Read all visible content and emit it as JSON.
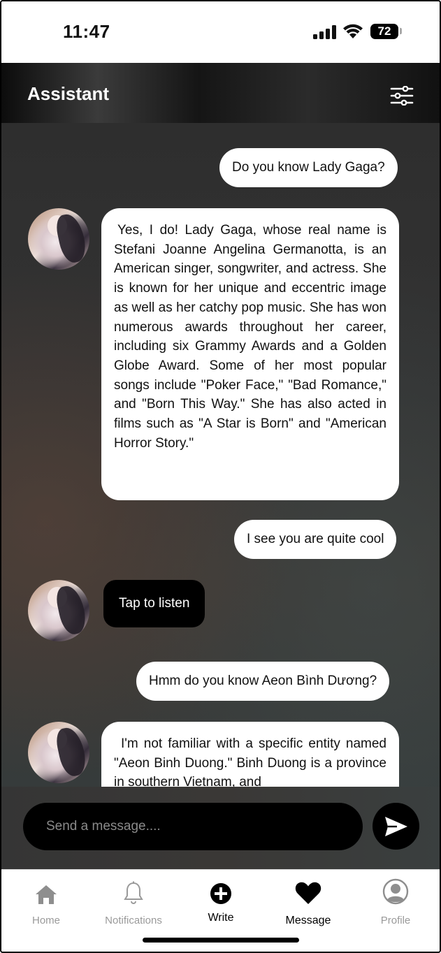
{
  "status_bar": {
    "time": "11:47",
    "battery": "72"
  },
  "header": {
    "title": "Assistant"
  },
  "messages": {
    "m1": "Do you know Lady Gaga?",
    "m2": "Yes, I do! Lady Gaga, whose real name is Stefani Joanne Angelina Germanotta, is an American singer, songwriter, and actress. She is known for her unique and eccentric image as well as her catchy pop music. She has won numerous awards throughout her career, including six Grammy Awards and a Golden Globe Award. Some of her most popular songs include \"Poker Face,\" \"Bad Romance,\" and \"Born This Way.\" She has also acted in films such as \"A Star is Born\" and \"American Horror Story.\"",
    "m3": "I see you are quite cool",
    "m4": "Tap to listen",
    "m5": "Hmm do you know Aeon Bình Dương?",
    "m6": "I'm not familiar with a specific entity named \"Aeon Binh Duong.\" Binh Duong is a province in southern Vietnam, and"
  },
  "composer": {
    "placeholder": "Send a message...."
  },
  "tabs": {
    "home": "Home",
    "notifications": "Notifications",
    "write": "Write",
    "message": "Message",
    "profile": "Profile"
  },
  "icons": {
    "status": [
      "signal-icon",
      "wifi-icon",
      "battery-icon"
    ],
    "header": [
      "settings-sliders-icon"
    ],
    "composer": [
      "send-icon"
    ],
    "tabs": [
      "home-icon",
      "bell-icon",
      "plus-circle-icon",
      "heart-icon",
      "user-circle-icon"
    ]
  }
}
